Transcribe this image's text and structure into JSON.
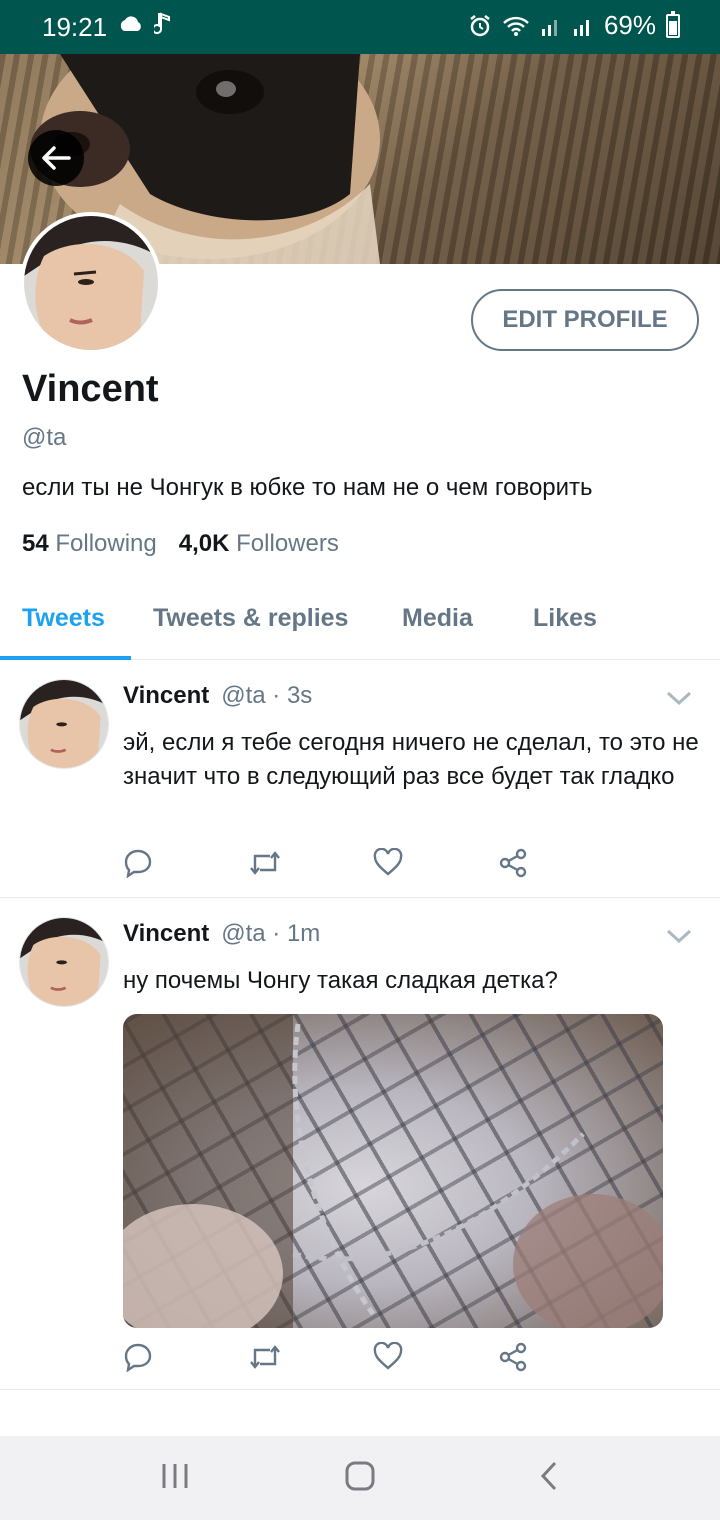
{
  "status_bar": {
    "time": "19:21",
    "battery": "69%",
    "battery_level": 0.69,
    "left_icons": [
      "cloud-icon",
      "music-note-icon"
    ],
    "right_icons": [
      "alarm-icon",
      "wifi-icon",
      "signal-icon",
      "signal-icon",
      "battery-icon"
    ]
  },
  "profile": {
    "name": "Vincent",
    "handle": "@ta",
    "bio": "если ты не Чонгук в юбке то нам не о чем говорить",
    "following_count": "54",
    "following_label": "Following",
    "followers_count": "4,0K",
    "followers_label": "Followers",
    "edit_button": "EDIT PROFILE"
  },
  "tabs": [
    {
      "label": "Tweets",
      "active": true
    },
    {
      "label": "Tweets & replies",
      "active": false
    },
    {
      "label": "Media",
      "active": false
    },
    {
      "label": "Likes",
      "active": false
    }
  ],
  "tweets": [
    {
      "name": "Vincent",
      "meta": "@ta · 3s",
      "text": "эй, если я тебе сегодня ничего не сделал, то это не значит что в следующий раз все будет так гладко",
      "has_media": false
    },
    {
      "name": "Vincent",
      "meta": "@ta · 1m",
      "text": "ну почемы Чонгу такая сладкая детка?",
      "has_media": true
    }
  ],
  "colors": {
    "status_bar": "#00564f",
    "accent": "#1da1f2",
    "muted": "#657786",
    "text": "#14171a"
  }
}
